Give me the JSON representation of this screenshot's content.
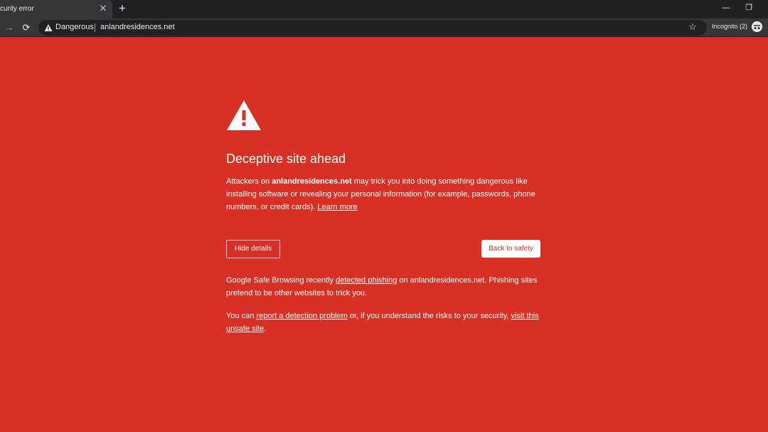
{
  "browser": {
    "tab_title": "curity error",
    "tab_close": "✕",
    "new_tab": "+",
    "minimize": "—",
    "restore": "❐",
    "back": "←",
    "forward": "→",
    "reload": "⟳",
    "security_state": "Dangerous",
    "url": "anlandresidences.net",
    "bookmark_star": "☆",
    "incognito_label": "Incognito (2)"
  },
  "page": {
    "headline": "Deceptive site ahead",
    "intro": {
      "prefix": "Attackers on ",
      "domain": "anlandresidences.net",
      "suffix": " may trick you into doing something dangerous like installing software or revealing your personal information (for example, passwords, phone numbers, or credit cards). ",
      "learn_more": "Learn more"
    },
    "hide_details_label": "Hide details",
    "back_to_safety_label": "Back to safety",
    "details": {
      "prefix": "Google Safe Browsing recently ",
      "detected_phishing": "detected phishing",
      "suffix": " on anlandresidences.net. Phishing sites pretend to be other websites to trick you."
    },
    "report": {
      "prefix": "You can ",
      "report_link": "report a detection problem",
      "middle": " or, if you understand the risks to your security, ",
      "visit_link": "visit this unsafe site",
      "end": "."
    }
  },
  "colors": {
    "background": "#d93025",
    "chrome_dark": "#202124",
    "chrome_toolbar": "#35363a"
  }
}
